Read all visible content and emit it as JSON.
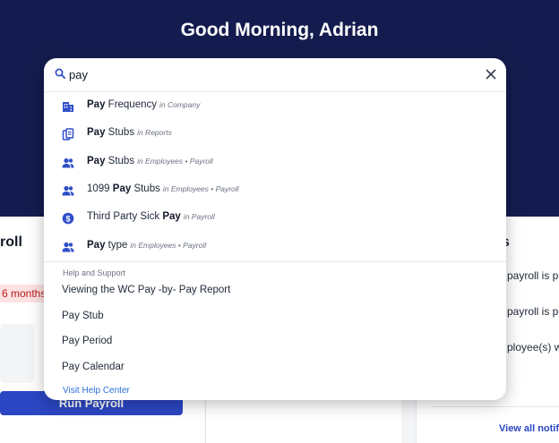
{
  "header": {
    "greeting": "Good Morning, Adrian"
  },
  "background": {
    "left_card_title": "roll",
    "months_badge": "6 months",
    "run_payroll_label": "Run Payroll",
    "right_card_title_fragment": "s",
    "right_lines": [
      "payroll is pa",
      "payroll is pa",
      "ployee(s) wi"
    ],
    "view_all": "View all notific"
  },
  "search": {
    "query": "pay",
    "results": [
      {
        "pre": "",
        "bold": "Pay",
        "post": " Frequency",
        "context": "in Company",
        "icon": "building-icon"
      },
      {
        "pre": "",
        "bold": "Pay",
        "post": " Stubs",
        "context": "in Reports",
        "icon": "report-icon"
      },
      {
        "pre": "",
        "bold": "Pay",
        "post": " Stubs",
        "context": "in Employees • Payroll",
        "icon": "people-icon"
      },
      {
        "pre": "1099 ",
        "bold": "Pay",
        "post": " Stubs",
        "context": "in Employees • Payroll",
        "icon": "people-icon"
      },
      {
        "pre": "Third Party Sick ",
        "bold": "Pay",
        "post": "",
        "context": "in Payroll",
        "icon": "dollar-icon"
      },
      {
        "pre": "",
        "bold": "Pay",
        "post": " type",
        "context": "in Employees • Payroll",
        "icon": "people-icon"
      }
    ],
    "help_heading": "Help and Support",
    "help_items": [
      "Viewing the WC Pay -by- Pay Report",
      "Pay Stub",
      "Pay Period",
      "Pay Calendar"
    ],
    "help_link": "Visit Help Center"
  },
  "colors": {
    "hero": "#141c4f",
    "accent": "#2b46c3",
    "icon_blue": "#2f4fc9",
    "link": "#2b6fd6"
  }
}
